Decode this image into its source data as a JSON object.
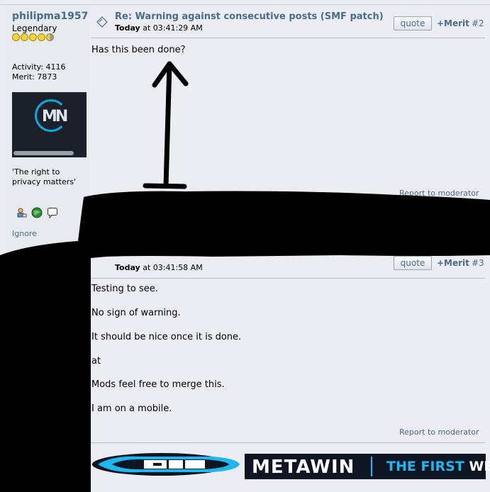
{
  "poster": {
    "name": "philipma1957",
    "rank": "Legendary",
    "activity_label": "Activity: 4116",
    "merit_label": "Merit: 7873",
    "signature_line1": "'The right to",
    "signature_line2": "privacy matters'",
    "ignore_label": "Ignore",
    "icons": [
      "profile-icon",
      "website-globe-icon",
      "message-bubble-icon"
    ],
    "star_count": 5
  },
  "posts": [
    {
      "title": "Re: Warning against consecutive posts (SMF patch)",
      "time_prefix": "Today",
      "time": " at 03:41:29 AM",
      "quote_label": "quote",
      "merit_label": "+Merit",
      "number": "#2",
      "body": [
        "Has this been done?"
      ],
      "report_label": "Report to moderator"
    },
    {
      "time_prefix": "Today",
      "time": " at 03:41:58 AM",
      "quote_label": "quote",
      "merit_label": "+Merit",
      "number": "#3",
      "body": [
        "Testing to see.",
        "No sign of warning.",
        "It should be nice once it is done.",
        "at",
        "Mods feel free to merge this.",
        "I am on a mobile."
      ],
      "report_label": "Report to moderator"
    }
  ],
  "banner": {
    "brand": "METAWIN",
    "tagline_blue": "THE FIRST",
    "tagline_white": " WE",
    "colors": {
      "accent": "#1fb7ef",
      "background": "#0f1623"
    }
  },
  "colors": {
    "link": "#476c8e",
    "redaction": "#000000"
  }
}
